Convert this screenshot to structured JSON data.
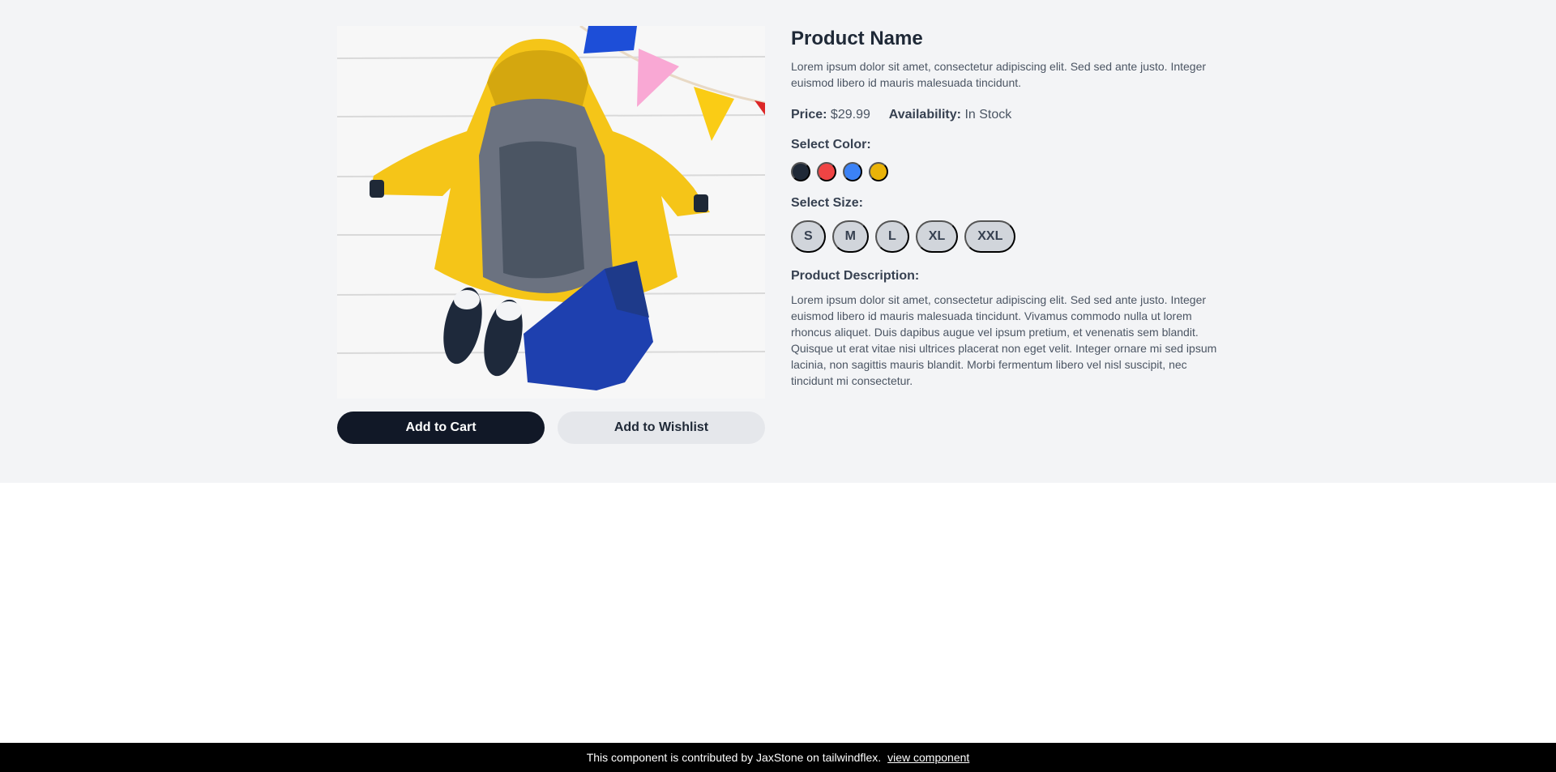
{
  "product": {
    "title": "Product Name",
    "subtitle": "Lorem ipsum dolor sit amet, consectetur adipiscing elit. Sed sed ante justo. Integer euismod libero id mauris malesuada tincidunt.",
    "price_label": "Price:",
    "price": "$29.99",
    "availability_label": "Availability:",
    "availability": "In Stock",
    "color_label": "Select Color:",
    "colors": [
      "#1f2937",
      "#ef4444",
      "#3b82f6",
      "#eab308"
    ],
    "size_label": "Select Size:",
    "sizes": [
      "S",
      "M",
      "L",
      "XL",
      "XXL"
    ],
    "description_label": "Product Description:",
    "description": "Lorem ipsum dolor sit amet, consectetur adipiscing elit. Sed sed ante justo. Integer euismod libero id mauris malesuada tincidunt. Vivamus commodo nulla ut lorem rhoncus aliquet. Duis dapibus augue vel ipsum pretium, et venenatis sem blandit. Quisque ut erat vitae nisi ultrices placerat non eget velit. Integer ornare mi sed ipsum lacinia, non sagittis mauris blandit. Morbi fermentum libero vel nisl suscipit, nec tincidunt mi consectetur."
  },
  "actions": {
    "add_to_cart": "Add to Cart",
    "add_to_wishlist": "Add to Wishlist"
  },
  "footer": {
    "text": "This component is contributed by JaxStone on tailwindflex.",
    "link": "view component"
  }
}
